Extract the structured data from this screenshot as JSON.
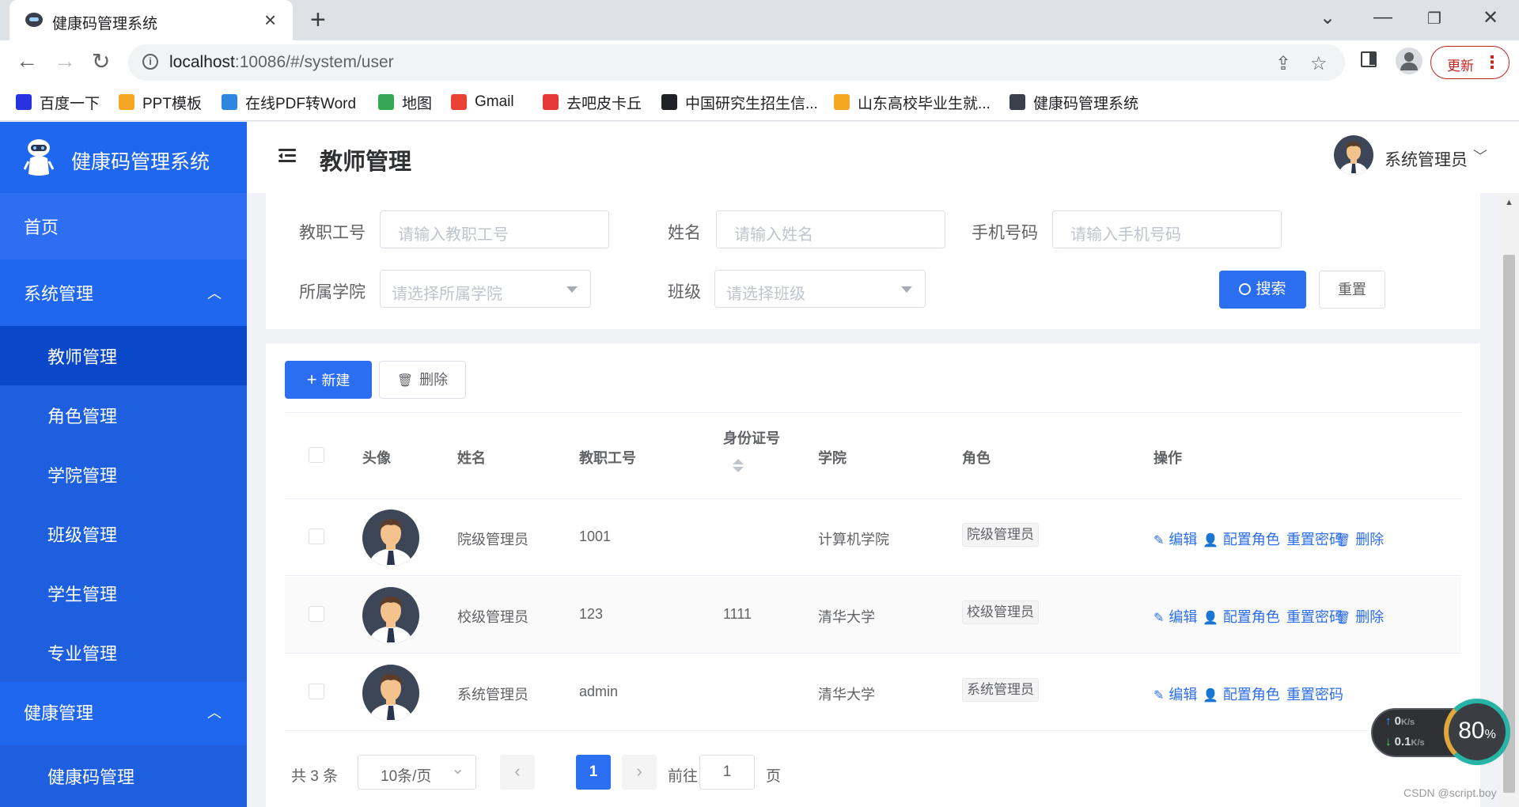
{
  "browser": {
    "tab_title": "健康码管理系统",
    "url_host": "localhost",
    "url_rest": ":10086/#/system/user",
    "update_label": "更新",
    "bookmarks": [
      {
        "label": "百度一下",
        "icon": "baidu-icon",
        "color": "#2932e1"
      },
      {
        "label": "PPT模板",
        "icon": "ppt-icon",
        "color": "#f5a623"
      },
      {
        "label": "在线PDF转Word",
        "icon": "pdf-icon",
        "color": "#2e86de"
      },
      {
        "label": "地图",
        "icon": "maps-icon",
        "color": "#34a853"
      },
      {
        "label": "Gmail",
        "icon": "gmail-icon",
        "color": "#ea4335"
      },
      {
        "label": "去吧皮卡丘",
        "icon": "watermelon-icon",
        "color": "#e53935"
      },
      {
        "label": "中国研究生招生信...",
        "icon": "graduation-cap-icon",
        "color": "#202124"
      },
      {
        "label": "山东高校毕业生就...",
        "icon": "shandong-icon",
        "color": "#f5a623"
      },
      {
        "label": "健康码管理系统",
        "icon": "robot-icon",
        "color": "#3a3f4b"
      }
    ]
  },
  "sidebar": {
    "brand": "健康码管理系统",
    "home": "首页",
    "system": "系统管理",
    "system_items": [
      "教师管理",
      "角色管理",
      "学院管理",
      "班级管理",
      "学生管理",
      "专业管理"
    ],
    "active_item": "教师管理",
    "health": "健康管理",
    "health_items": [
      "健康码管理"
    ]
  },
  "header": {
    "title": "教师管理",
    "user": "系统管理员"
  },
  "search": {
    "staff_no_label": "教职工号",
    "staff_no_placeholder": "请输入教职工号",
    "name_label": "姓名",
    "name_placeholder": "请输入姓名",
    "phone_label": "手机号码",
    "phone_placeholder": "请输入手机号码",
    "college_label": "所属学院",
    "college_placeholder": "请选择所属学院",
    "class_label": "班级",
    "class_placeholder": "请选择班级",
    "search_btn": "搜索",
    "reset_btn": "重置"
  },
  "toolbar": {
    "new_btn": "新建",
    "delete_btn": "删除"
  },
  "table": {
    "columns": [
      "头像",
      "姓名",
      "教职工号",
      "身份证号",
      "学院",
      "角色",
      "操作"
    ],
    "rows": [
      {
        "name": "院级管理员",
        "staff_no": "1001",
        "id_no": "",
        "college": "计算机学院",
        "role": "院级管理员",
        "ops": [
          "编辑",
          "配置角色",
          "重置密码",
          "删除"
        ]
      },
      {
        "name": "校级管理员",
        "staff_no": "123",
        "id_no": "1111",
        "college": "清华大学",
        "role": "校级管理员",
        "ops": [
          "编辑",
          "配置角色",
          "重置密码",
          "删除"
        ]
      },
      {
        "name": "系统管理员",
        "staff_no": "admin",
        "id_no": "",
        "college": "清华大学",
        "role": "系统管理员",
        "ops": [
          "编辑",
          "配置角色",
          "重置密码"
        ]
      }
    ]
  },
  "pagination": {
    "total": "共 3 条",
    "page_size": "10条/页",
    "current": "1",
    "goto_label": "前往",
    "goto_value": "1",
    "page_unit": "页"
  },
  "widget": {
    "up_speed": "0",
    "down_speed": "0.1",
    "speed_unit": "K/s",
    "percent": "80"
  },
  "watermark": "CSDN @script.boy",
  "colors": {
    "primary": "#2c6ef2",
    "sidebar_bg": "#2067f0",
    "sidebar_active": "#0b47c9"
  }
}
